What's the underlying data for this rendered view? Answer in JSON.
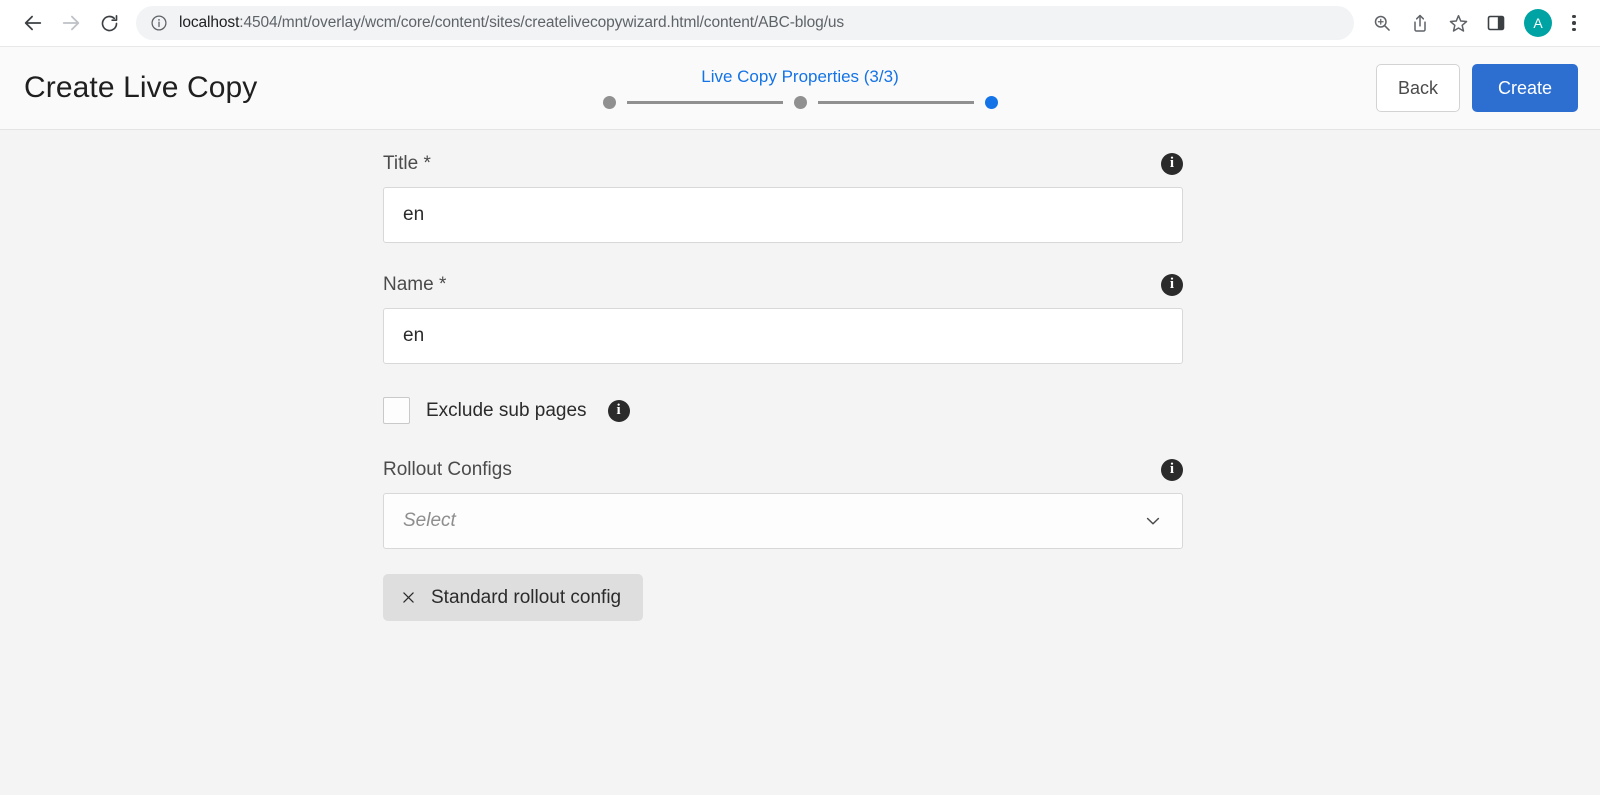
{
  "browser": {
    "back_icon": "arrow-left-icon",
    "forward_icon": "arrow-right-icon",
    "reload_icon": "reload-icon",
    "site_info_icon": "info-circle-icon",
    "url_host": "localhost",
    "url_path": ":4504/mnt/overlay/wcm/core/content/sites/createlivecopywizard.html/content/ABC-blog/us",
    "url_full": "localhost:4504/mnt/overlay/wcm/core/content/sites/createlivecopywizard.html/content/ABC-blog/us",
    "toolbar_icons": [
      "zoom-icon",
      "share-icon",
      "bookmark-star-icon",
      "side-panel-icon"
    ],
    "avatar_initial": "A",
    "menu_icon": "three-dot-menu-icon"
  },
  "header": {
    "title": "Create Live Copy",
    "step_label": "Live Copy Properties (3/3)",
    "steps": [
      {
        "name": "step-1",
        "state": "done"
      },
      {
        "name": "step-2",
        "state": "done"
      },
      {
        "name": "step-3",
        "state": "active"
      }
    ],
    "back_label": "Back",
    "create_label": "Create",
    "accent_color": "#1473e6",
    "primary_button_color": "#2d6fd1"
  },
  "form": {
    "title_field": {
      "label": "Title *",
      "value": "en",
      "placeholder": "",
      "info_icon": "info-icon"
    },
    "name_field": {
      "label": "Name *",
      "value": "en",
      "placeholder": "",
      "info_icon": "info-icon"
    },
    "exclude_sub_pages": {
      "label": "Exclude sub pages",
      "checked": false,
      "info_icon": "info-icon"
    },
    "rollout_configs": {
      "label": "Rollout Configs",
      "placeholder": "Select",
      "selected_value": "",
      "info_icon": "info-icon",
      "chevron_icon": "chevron-down-icon",
      "chips": [
        {
          "label": "Standard rollout config",
          "remove_icon": "close-icon"
        }
      ]
    }
  }
}
